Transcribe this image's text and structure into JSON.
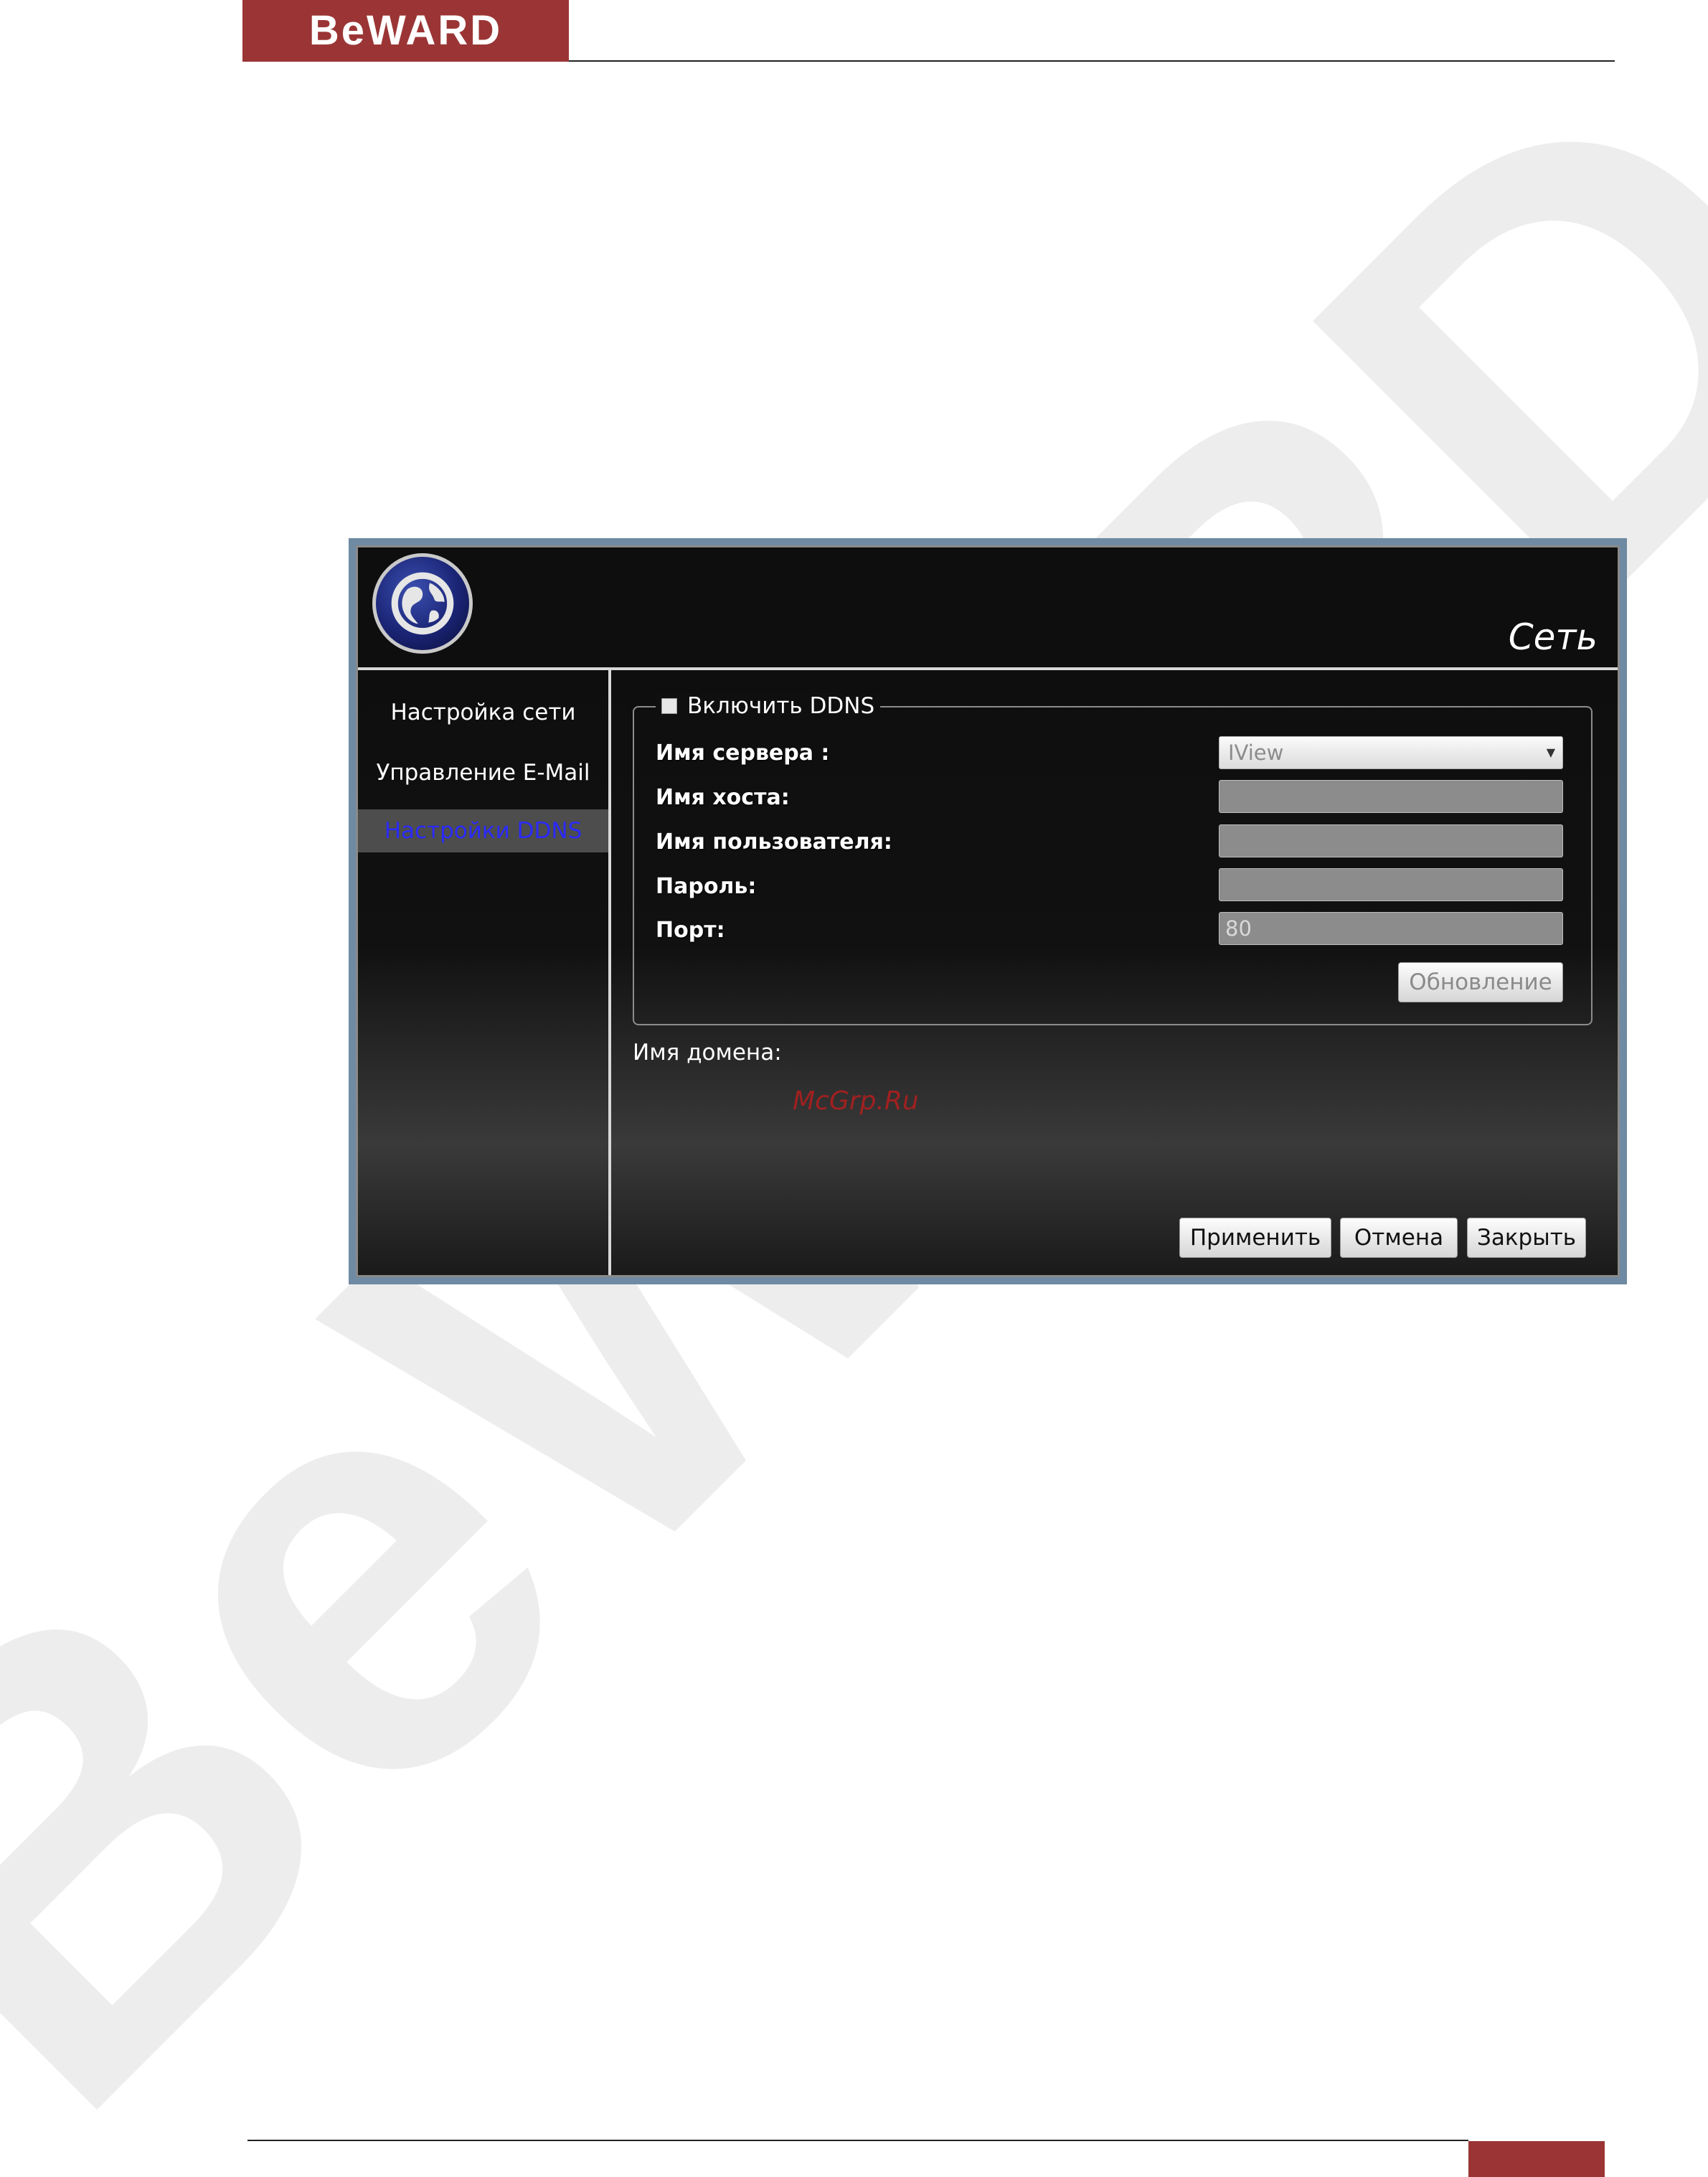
{
  "page": {
    "brand": "BeWARD",
    "watermark_text": "BeWARD",
    "colors": {
      "brand_red": "#9b3535",
      "active_nav_text": "#2a2aff",
      "watermark": "#ededed"
    }
  },
  "window": {
    "title": "Сеть",
    "icon": "globe-icon"
  },
  "sidebar": {
    "items": [
      {
        "label": "Настройка сети",
        "active": false
      },
      {
        "label": "Управление E-Mail",
        "active": false
      },
      {
        "label": "Настройки DDNS",
        "active": true
      }
    ]
  },
  "ddns": {
    "enable_label": "Включить DDNS",
    "enabled": false,
    "server_label": "Имя сервера :",
    "server_value": "IView",
    "host_label": "Имя хоста:",
    "host_value": "",
    "user_label": "Имя пользователя:",
    "user_value": "",
    "password_label": "Пароль:",
    "password_value": "",
    "port_label": "Порт:",
    "port_value": "80",
    "update_button": "Обновление"
  },
  "domain": {
    "label": "Имя домена:",
    "overlay": "McGrp.Ru"
  },
  "actions": {
    "apply": "Применить",
    "cancel": "Отмена",
    "close": "Закрыть"
  }
}
